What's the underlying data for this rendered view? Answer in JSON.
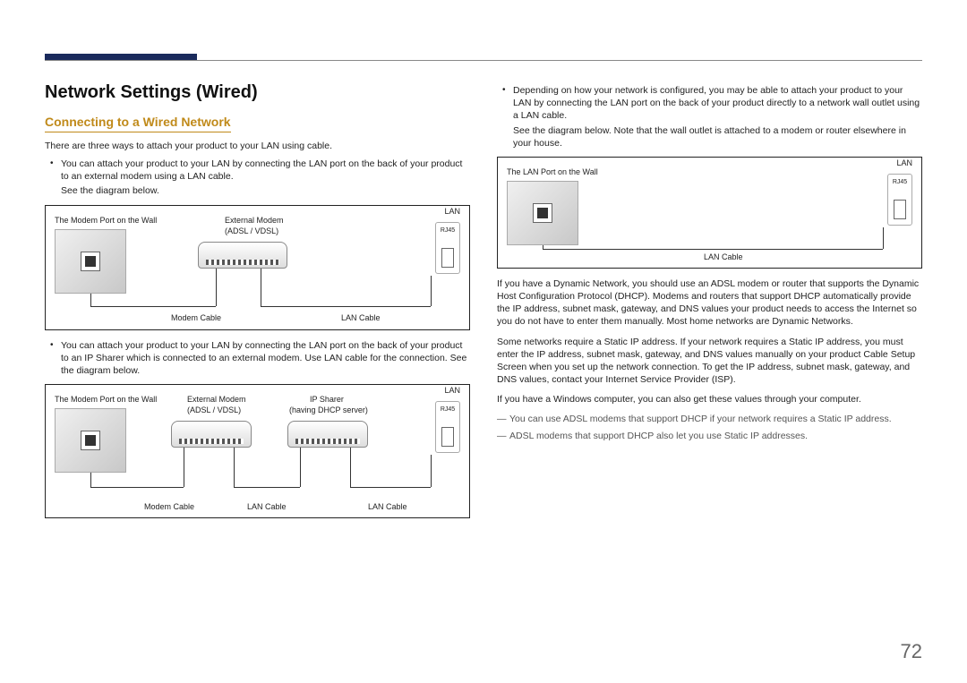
{
  "page_number": "72",
  "heading": "Network Settings (Wired)",
  "subheading": "Connecting to a Wired Network",
  "left": {
    "intro": "There are three ways to attach your product to your LAN using cable.",
    "b1_main": "You can attach your product to your LAN by connecting the LAN port on the back of your product to an external modem using a LAN cable.",
    "b1_sub": "See the diagram below.",
    "b2_main": "You can attach your product to your LAN by connecting the LAN port on the back of your product to an IP Sharer which is connected to an external modem. Use LAN cable for the connection. See the diagram below."
  },
  "diagram1": {
    "wall_label": "The Modem Port on the Wall",
    "modem_label_top": "External Modem",
    "modem_label_sub": "(ADSL / VDSL)",
    "lan": "LAN",
    "rj45": "RJ45",
    "modem_cable": "Modem Cable",
    "lan_cable": "LAN Cable"
  },
  "diagram2": {
    "wall_label": "The Modem Port on the Wall",
    "modem_label_top": "External Modem",
    "modem_label_sub": "(ADSL / VDSL)",
    "sharer_top": "IP Sharer",
    "sharer_sub": "(having DHCP server)",
    "lan": "LAN",
    "rj45": "RJ45",
    "modem_cable": "Modem Cable",
    "lan_cable_a": "LAN Cable",
    "lan_cable_b": "LAN Cable"
  },
  "right": {
    "b3_main": "Depending on how your network is configured, you may be able to attach your product to your LAN by connecting the LAN port on the back of your product directly to a network wall outlet using a LAN cable.",
    "b3_sub": "See the diagram below. Note that the wall outlet is attached to a modem or router elsewhere in your house.",
    "p_dhcp": "If you have a Dynamic Network, you should use an ADSL modem or router that supports the Dynamic Host Configuration Protocol (DHCP). Modems and routers that support DHCP automatically provide the IP address, subnet mask, gateway, and DNS values your product needs to access the Internet so you do not have to enter them manually. Most home networks are Dynamic Networks.",
    "p_static": "Some networks require a Static IP address. If your network requires a Static IP address, you must enter the IP address, subnet mask, gateway, and DNS values manually on your product Cable Setup Screen when you set up the network connection. To get the IP address, subnet mask, gateway, and DNS values, contact your Internet Service Provider (ISP).",
    "p_windows": "If you have a Windows computer, you can also get these values through your computer.",
    "dash1": "You can use ADSL modems that support DHCP if your network requires a Static IP address.",
    "dash2": "ADSL modems that support DHCP also let you use Static IP addresses."
  },
  "diagram3": {
    "wall_label": "The LAN Port on the Wall",
    "lan": "LAN",
    "rj45": "RJ45",
    "lan_cable": "LAN Cable"
  }
}
